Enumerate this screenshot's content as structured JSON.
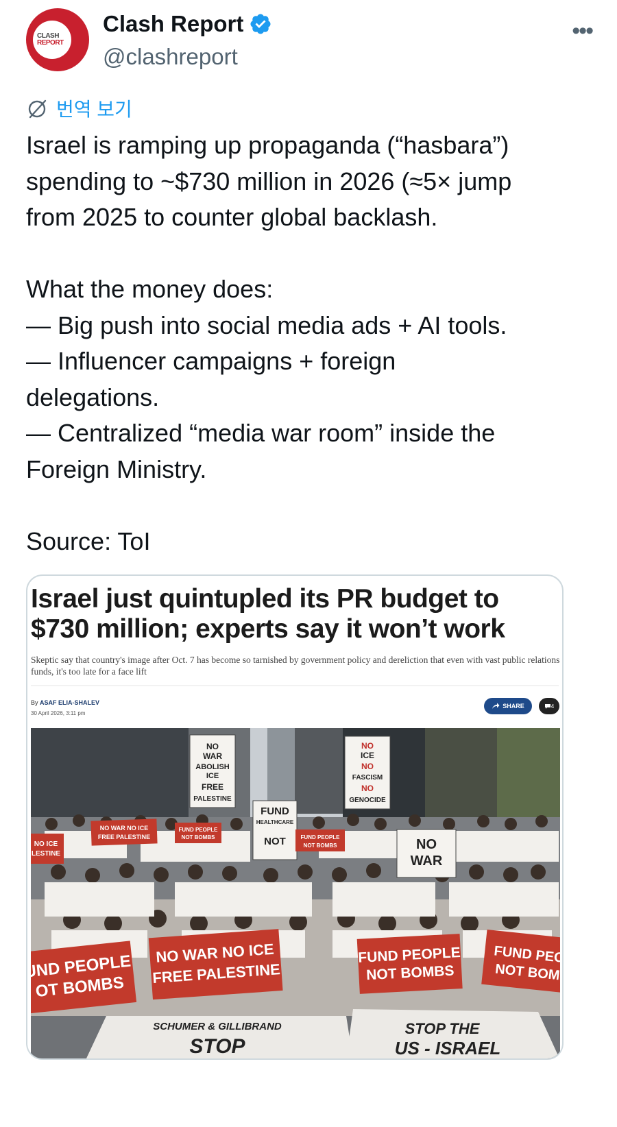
{
  "tweet": {
    "avatar": {
      "line1": "CLASH",
      "line2": "REPORT",
      "color": "#c8202e"
    },
    "display_name": "Clash Report",
    "handle": "@clashreport",
    "verified_icon": "verified-badge-icon",
    "more_icon": "more-icon",
    "more_label": "•••",
    "translate_label": "번역 보기",
    "paragraphs": [
      "Israel is ramping up propaganda (“hasbara”)",
      "spending to ~$730 million in 2026 (≈5× jump",
      "from 2025 to counter global backlash.",
      "",
      "What the money does:",
      "— Big push into social media ads + AI tools.",
      "— Influencer campaigns + foreign",
      "delegations.",
      "— Centralized “media war room” inside the",
      "Foreign Ministry.",
      "",
      "Source: ToI"
    ]
  },
  "article": {
    "title_line1": "Israel just quintupled its PR budget to",
    "title_line2": "$730 million; experts say it won’t work",
    "subtitle": "Skeptic say that country's image after Oct. 7 has become so tarnished by government policy and dereliction that even with vast public relations funds, it's too late for a face lift",
    "byline_prefix": "By ",
    "author": "ASAF ELIA-SHALEV",
    "date": "30 April 2026, 3:11 pm",
    "share_label": "SHARE",
    "comment_count": "4"
  },
  "photo_signs": {
    "sign1": [
      "NO",
      "WAR",
      "ABOLISH",
      "ICE",
      "FREE",
      "PALESTINE"
    ],
    "sign2": [
      "NO",
      "ICE",
      "NO",
      "FASCISM",
      "NO",
      "GENOCIDE"
    ],
    "sign3": [
      "FUND",
      "HEALTHCARE",
      "NOT"
    ],
    "sign4": [
      "NO",
      "WAR"
    ],
    "banner1": [
      "NO WAR NO ICE",
      "FREE PALESTINE"
    ],
    "banner2": [
      "FUND PEOPLE",
      "NOT BOMBS"
    ],
    "banner3": [
      "FUND PEOPLE",
      "NOT BOMBS"
    ],
    "big1": [
      "UND PEOPLE",
      "OT BOMBS"
    ],
    "big2": [
      "NO WAR NO ICE",
      "FREE PALESTINE"
    ],
    "big3": [
      "FUND PEOPLE",
      "NOT BOMBS"
    ],
    "big4": [
      "FUND PEO",
      "NOT BOM"
    ],
    "left_sign": [
      "NO ICE",
      "LESTINE"
    ],
    "street1": [
      "SCHUMER & GILLIBRAND",
      "STOP"
    ],
    "street2": [
      "STOP THE",
      "US - ISRAEL"
    ]
  }
}
